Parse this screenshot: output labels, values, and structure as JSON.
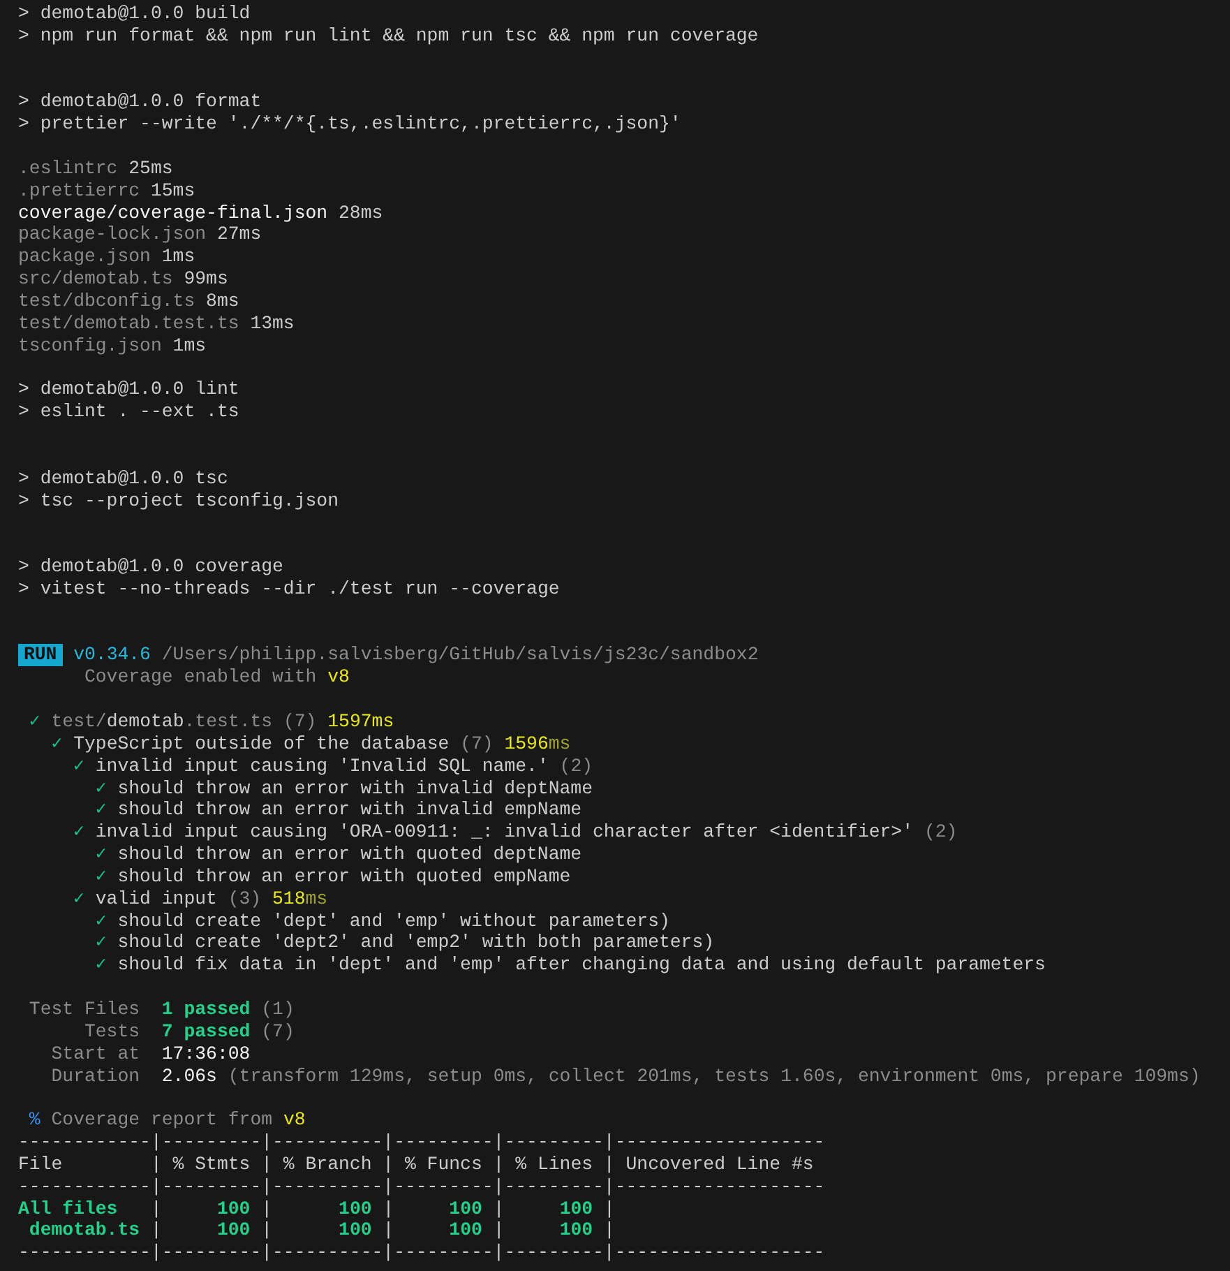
{
  "terminal": {
    "output": [
      {
        "kind": "line",
        "segments": [
          {
            "text": "> demotab@1.0.0 build",
            "kind": "normal"
          }
        ]
      },
      {
        "kind": "line",
        "segments": [
          {
            "text": "> npm run format && npm run lint && npm run tsc && npm run coverage",
            "kind": "normal"
          }
        ]
      },
      {
        "kind": "blank"
      },
      {
        "kind": "blank"
      },
      {
        "kind": "line",
        "segments": [
          {
            "text": "> demotab@1.0.0 format",
            "kind": "normal"
          }
        ]
      },
      {
        "kind": "line",
        "segments": [
          {
            "text": "> prettier --write './**/*{.ts,.eslintrc,.prettierrc,.json}'",
            "kind": "normal"
          }
        ]
      },
      {
        "kind": "blank"
      },
      {
        "kind": "line",
        "segments": [
          {
            "text": ".eslintrc",
            "kind": "dim"
          },
          {
            "text": " 25ms",
            "kind": "normal"
          }
        ]
      },
      {
        "kind": "line",
        "segments": [
          {
            "text": ".prettierrc",
            "kind": "dim"
          },
          {
            "text": " 15ms",
            "kind": "normal"
          }
        ]
      },
      {
        "kind": "line",
        "segments": [
          {
            "text": "coverage/coverage-final.json",
            "kind": "bright"
          },
          {
            "text": " 28ms",
            "kind": "normal"
          }
        ]
      },
      {
        "kind": "line",
        "segments": [
          {
            "text": "package-lock.json",
            "kind": "dim"
          },
          {
            "text": " 27ms",
            "kind": "normal"
          }
        ]
      },
      {
        "kind": "line",
        "segments": [
          {
            "text": "package.json",
            "kind": "dim"
          },
          {
            "text": " 1ms",
            "kind": "normal"
          }
        ]
      },
      {
        "kind": "line",
        "segments": [
          {
            "text": "src/demotab.ts",
            "kind": "dim"
          },
          {
            "text": " 99ms",
            "kind": "normal"
          }
        ]
      },
      {
        "kind": "line",
        "segments": [
          {
            "text": "test/dbconfig.ts",
            "kind": "dim"
          },
          {
            "text": " 8ms",
            "kind": "normal"
          }
        ]
      },
      {
        "kind": "line",
        "segments": [
          {
            "text": "test/demotab.test.ts",
            "kind": "dim"
          },
          {
            "text": " 13ms",
            "kind": "normal"
          }
        ]
      },
      {
        "kind": "line",
        "segments": [
          {
            "text": "tsconfig.json",
            "kind": "dim"
          },
          {
            "text": " 1ms",
            "kind": "normal"
          }
        ]
      },
      {
        "kind": "blank"
      },
      {
        "kind": "line",
        "segments": [
          {
            "text": "> demotab@1.0.0 lint",
            "kind": "normal"
          }
        ]
      },
      {
        "kind": "line",
        "segments": [
          {
            "text": "> eslint . --ext .ts",
            "kind": "normal"
          }
        ]
      },
      {
        "kind": "blank"
      },
      {
        "kind": "blank"
      },
      {
        "kind": "line",
        "segments": [
          {
            "text": "> demotab@1.0.0 tsc",
            "kind": "normal"
          }
        ]
      },
      {
        "kind": "line",
        "segments": [
          {
            "text": "> tsc --project tsconfig.json",
            "kind": "normal"
          }
        ]
      },
      {
        "kind": "blank"
      },
      {
        "kind": "blank"
      },
      {
        "kind": "line",
        "segments": [
          {
            "text": "> demotab@1.0.0 coverage",
            "kind": "normal"
          }
        ]
      },
      {
        "kind": "line",
        "segments": [
          {
            "text": "> vitest --no-threads --dir ./test run --coverage",
            "kind": "normal"
          }
        ]
      },
      {
        "kind": "blank"
      },
      {
        "kind": "blank"
      },
      {
        "kind": "run",
        "badge": "RUN",
        "segments": [
          {
            "text": "v0.34.6",
            "kind": "cyan"
          },
          {
            "text": " /Users/philipp.salvisberg/GitHub/salvis/js23c/sandbox2",
            "kind": "dim"
          }
        ]
      },
      {
        "kind": "line",
        "segments": [
          {
            "text": "      Coverage enabled with ",
            "kind": "dim"
          },
          {
            "text": "v8",
            "kind": "yellow"
          }
        ]
      },
      {
        "kind": "blank"
      },
      {
        "kind": "tree",
        "nodes": [
          {
            "segments": [
              {
                "text": "✓ ",
                "kind": "pass"
              },
              {
                "text": "test/",
                "kind": "dim"
              },
              {
                "text": "demotab",
                "kind": "normal"
              },
              {
                "text": ".test.ts (7) ",
                "kind": "dim"
              },
              {
                "text": "1597ms",
                "kind": "yellow"
              }
            ],
            "children": [
              {
                "segments": [
                  {
                    "text": "✓ ",
                    "kind": "pass"
                  },
                  {
                    "text": "TypeScript outside of the database ",
                    "kind": "normal"
                  },
                  {
                    "text": "(7) ",
                    "kind": "dim"
                  },
                  {
                    "text": "1596",
                    "kind": "yellow"
                  },
                  {
                    "text": "ms",
                    "kind": "dimyellow"
                  }
                ],
                "children": [
                  {
                    "segments": [
                      {
                        "text": "✓ ",
                        "kind": "pass"
                      },
                      {
                        "text": "invalid input causing 'Invalid SQL name.' ",
                        "kind": "normal"
                      },
                      {
                        "text": "(2)",
                        "kind": "dim"
                      }
                    ],
                    "children": [
                      {
                        "segments": [
                          {
                            "text": "✓ ",
                            "kind": "pass"
                          },
                          {
                            "text": "should throw an error with invalid deptName",
                            "kind": "normal"
                          }
                        ]
                      },
                      {
                        "segments": [
                          {
                            "text": "✓ ",
                            "kind": "pass"
                          },
                          {
                            "text": "should throw an error with invalid empName",
                            "kind": "normal"
                          }
                        ]
                      }
                    ]
                  },
                  {
                    "segments": [
                      {
                        "text": "✓ ",
                        "kind": "pass"
                      },
                      {
                        "text": "invalid input causing 'ORA-00911: _: invalid character after <identifier>' ",
                        "kind": "normal"
                      },
                      {
                        "text": "(2)",
                        "kind": "dim"
                      }
                    ],
                    "children": [
                      {
                        "segments": [
                          {
                            "text": "✓ ",
                            "kind": "pass"
                          },
                          {
                            "text": "should throw an error with quoted deptName",
                            "kind": "normal"
                          }
                        ]
                      },
                      {
                        "segments": [
                          {
                            "text": "✓ ",
                            "kind": "pass"
                          },
                          {
                            "text": "should throw an error with quoted empName",
                            "kind": "normal"
                          }
                        ]
                      }
                    ]
                  },
                  {
                    "segments": [
                      {
                        "text": "✓ ",
                        "kind": "pass"
                      },
                      {
                        "text": "valid input ",
                        "kind": "normal"
                      },
                      {
                        "text": "(3) ",
                        "kind": "dim"
                      },
                      {
                        "text": "518",
                        "kind": "yellow"
                      },
                      {
                        "text": "ms",
                        "kind": "dimyellow"
                      }
                    ],
                    "children": [
                      {
                        "segments": [
                          {
                            "text": "✓ ",
                            "kind": "pass"
                          },
                          {
                            "text": "should create 'dept' and 'emp' without parameters)",
                            "kind": "normal"
                          }
                        ]
                      },
                      {
                        "segments": [
                          {
                            "text": "✓ ",
                            "kind": "pass"
                          },
                          {
                            "text": "should create 'dept2' and 'emp2' with both parameters)",
                            "kind": "normal"
                          }
                        ]
                      },
                      {
                        "segments": [
                          {
                            "text": "✓ ",
                            "kind": "pass"
                          },
                          {
                            "text": "should fix data in 'dept' and 'emp' after changing data and using default parameters",
                            "kind": "normal"
                          }
                        ]
                      }
                    ]
                  }
                ]
              }
            ]
          }
        ]
      },
      {
        "kind": "blank"
      },
      {
        "kind": "line",
        "segments": [
          {
            "text": " Test Files  ",
            "kind": "dim"
          },
          {
            "text": "1 passed",
            "kind": "green"
          },
          {
            "text": " (1)",
            "kind": "dim"
          }
        ]
      },
      {
        "kind": "line",
        "segments": [
          {
            "text": "      Tests  ",
            "kind": "dim"
          },
          {
            "text": "7 passed",
            "kind": "green"
          },
          {
            "text": " (7)",
            "kind": "dim"
          }
        ]
      },
      {
        "kind": "line",
        "segments": [
          {
            "text": "   Start at  ",
            "kind": "dim"
          },
          {
            "text": "17:36:08",
            "kind": "bright"
          }
        ]
      },
      {
        "kind": "line",
        "segments": [
          {
            "text": "   Duration  ",
            "kind": "dim"
          },
          {
            "text": "2.06s",
            "kind": "bright"
          },
          {
            "text": " (transform 129ms, setup 0ms, collect 201ms, tests 1.60s, environment 0ms, prepare 109ms)",
            "kind": "dim"
          }
        ]
      },
      {
        "kind": "blank"
      },
      {
        "kind": "line",
        "segments": [
          {
            "text": " %",
            "kind": "blue"
          },
          {
            "text": " Coverage report from ",
            "kind": "dim"
          },
          {
            "text": "v8",
            "kind": "yellow"
          }
        ]
      },
      {
        "kind": "table_line",
        "segments": [
          {
            "text": "------------|---------|----------|---------|---------|-------------------",
            "kind": "normal"
          }
        ]
      },
      {
        "kind": "table_line",
        "segments": [
          {
            "text": "File        | % Stmts | % Branch | % Funcs | % Lines | Uncovered Line #s ",
            "kind": "normal"
          }
        ]
      },
      {
        "kind": "table_line",
        "segments": [
          {
            "text": "------------|---------|----------|---------|---------|-------------------",
            "kind": "normal"
          }
        ]
      },
      {
        "kind": "table_line",
        "segments": [
          {
            "text": "All files   ",
            "kind": "green"
          },
          {
            "text": "|",
            "kind": "normal"
          },
          {
            "text": "     100 ",
            "kind": "green"
          },
          {
            "text": "|",
            "kind": "normal"
          },
          {
            "text": "      100 ",
            "kind": "green"
          },
          {
            "text": "|",
            "kind": "normal"
          },
          {
            "text": "     100 ",
            "kind": "green"
          },
          {
            "text": "|",
            "kind": "normal"
          },
          {
            "text": "     100 ",
            "kind": "green"
          },
          {
            "text": "|",
            "kind": "normal"
          }
        ]
      },
      {
        "kind": "table_line",
        "segments": [
          {
            "text": " demotab.ts ",
            "kind": "green"
          },
          {
            "text": "|",
            "kind": "normal"
          },
          {
            "text": "     100 ",
            "kind": "green"
          },
          {
            "text": "|",
            "kind": "normal"
          },
          {
            "text": "      100 ",
            "kind": "green"
          },
          {
            "text": "|",
            "kind": "normal"
          },
          {
            "text": "     100 ",
            "kind": "green"
          },
          {
            "text": "|",
            "kind": "normal"
          },
          {
            "text": "     100 ",
            "kind": "green"
          },
          {
            "text": "|",
            "kind": "normal"
          }
        ]
      },
      {
        "kind": "table_line",
        "segments": [
          {
            "text": "------------|---------|----------|---------|---------|-------------------",
            "kind": "normal"
          }
        ]
      }
    ]
  }
}
